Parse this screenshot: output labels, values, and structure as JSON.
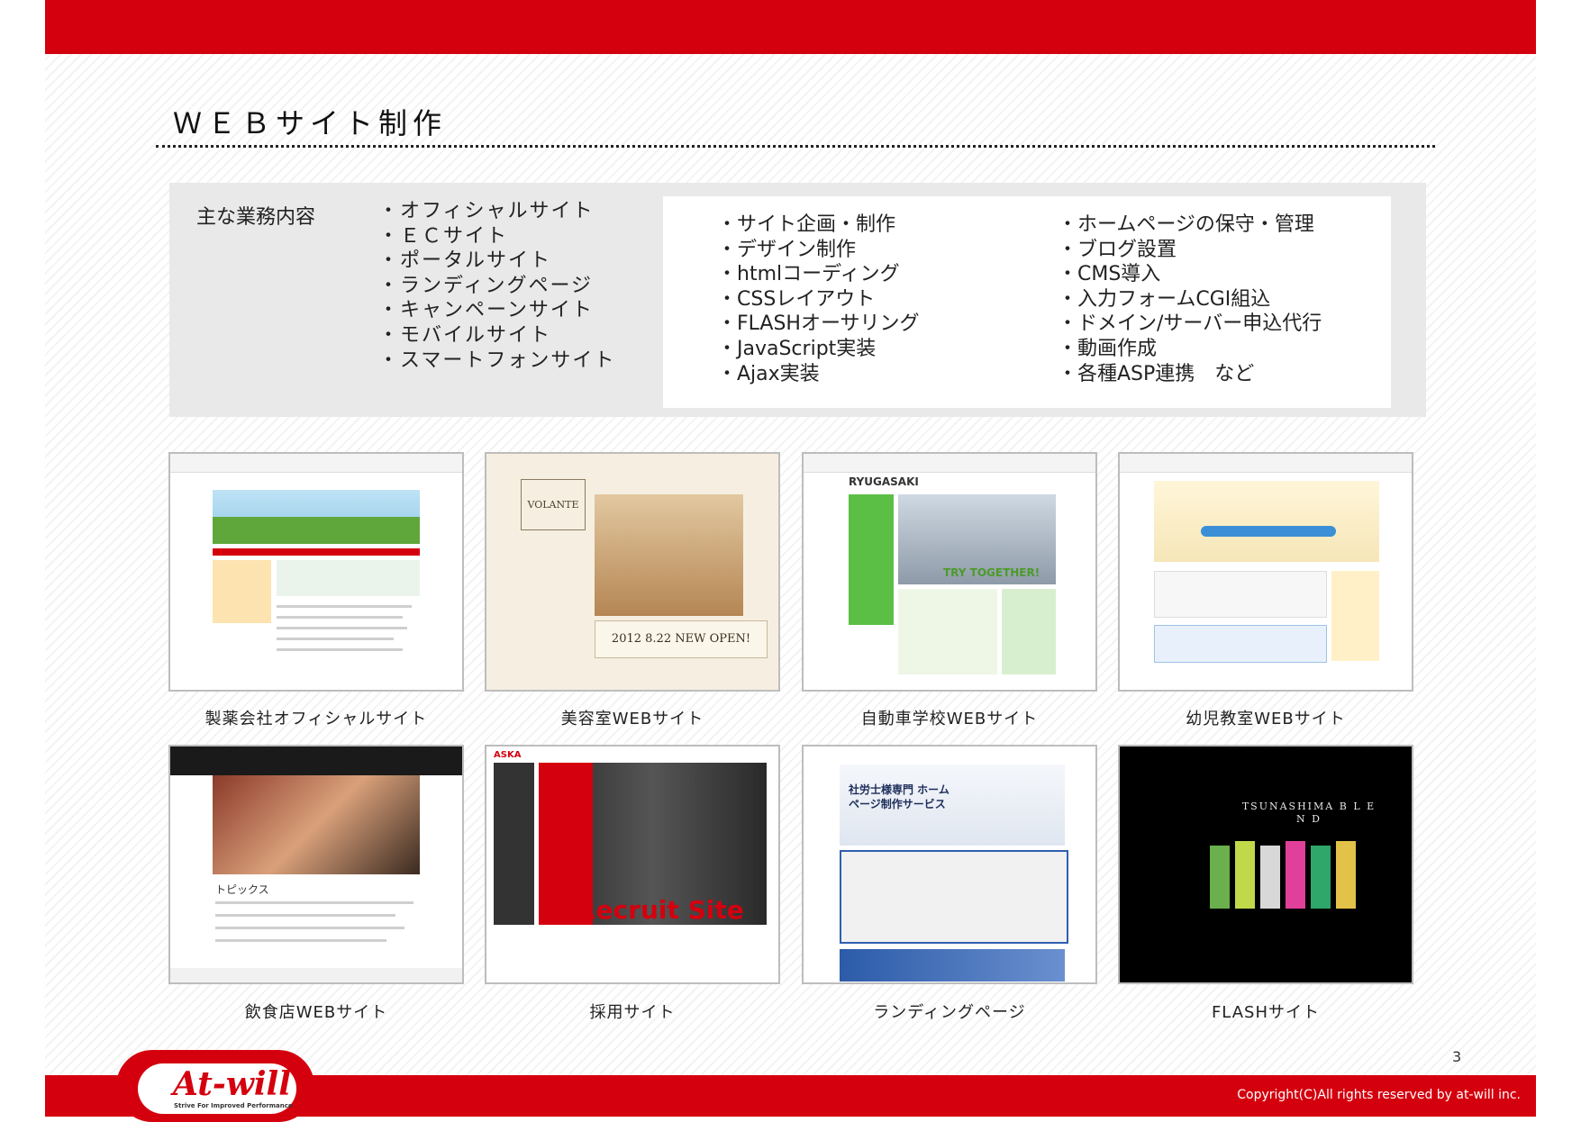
{
  "header": {
    "title": "ＷＥＢサイト制作"
  },
  "services": {
    "label": "主な業務内容",
    "site_types": [
      "・オフィシャルサイト",
      "・ＥＣサイト",
      "・ポータルサイト",
      "・ランディングページ",
      "・キャンペーンサイト",
      "・モバイルサイト",
      "・スマートフォンサイト"
    ],
    "production": [
      "・サイト企画・制作",
      "・デザイン制作",
      "・htmlコーディング",
      "・CSSレイアウト",
      "・FLASHオーサリング",
      "・JavaScript実装",
      "・Ajax実装"
    ],
    "maintenance": [
      "・ホームページの保守・管理",
      "・ブログ設置",
      "・CMS導入",
      "・入力フォームCGI組込",
      "・ドメイン/サーバー申込代行",
      "・動画作成",
      "・各種ASP連携　など"
    ]
  },
  "portfolio": [
    {
      "caption": "製薬会社オフィシャルサイト"
    },
    {
      "caption": "美容室WEBサイト",
      "shot_text": "2012 8.22 NEW OPEN!",
      "logo": "VOLANTE"
    },
    {
      "caption": "自動車学校WEBサイト",
      "shot_text": "TRY TOGETHER!",
      "logo": "RYUGASAKI"
    },
    {
      "caption": "幼児教室WEBサイト"
    },
    {
      "caption": "飲食店WEBサイト",
      "shot_text": "トピックス"
    },
    {
      "caption": "採用サイト",
      "shot_text": "Recruit Site",
      "logo": "ASKA"
    },
    {
      "caption": "ランディングページ",
      "shot_text": "社労士様専門 ホームページ制作サービス"
    },
    {
      "caption": "FLASHサイト",
      "shot_text": "TSUNASHIMA B L E N D"
    }
  ],
  "footer": {
    "page_number": "3",
    "copyright": "Copyright(C)All rights reserved by at-will inc.",
    "logo_text": "At-will",
    "tagline": "Strive For Improved Performance"
  },
  "colors": {
    "brand_red": "#d4000e"
  }
}
